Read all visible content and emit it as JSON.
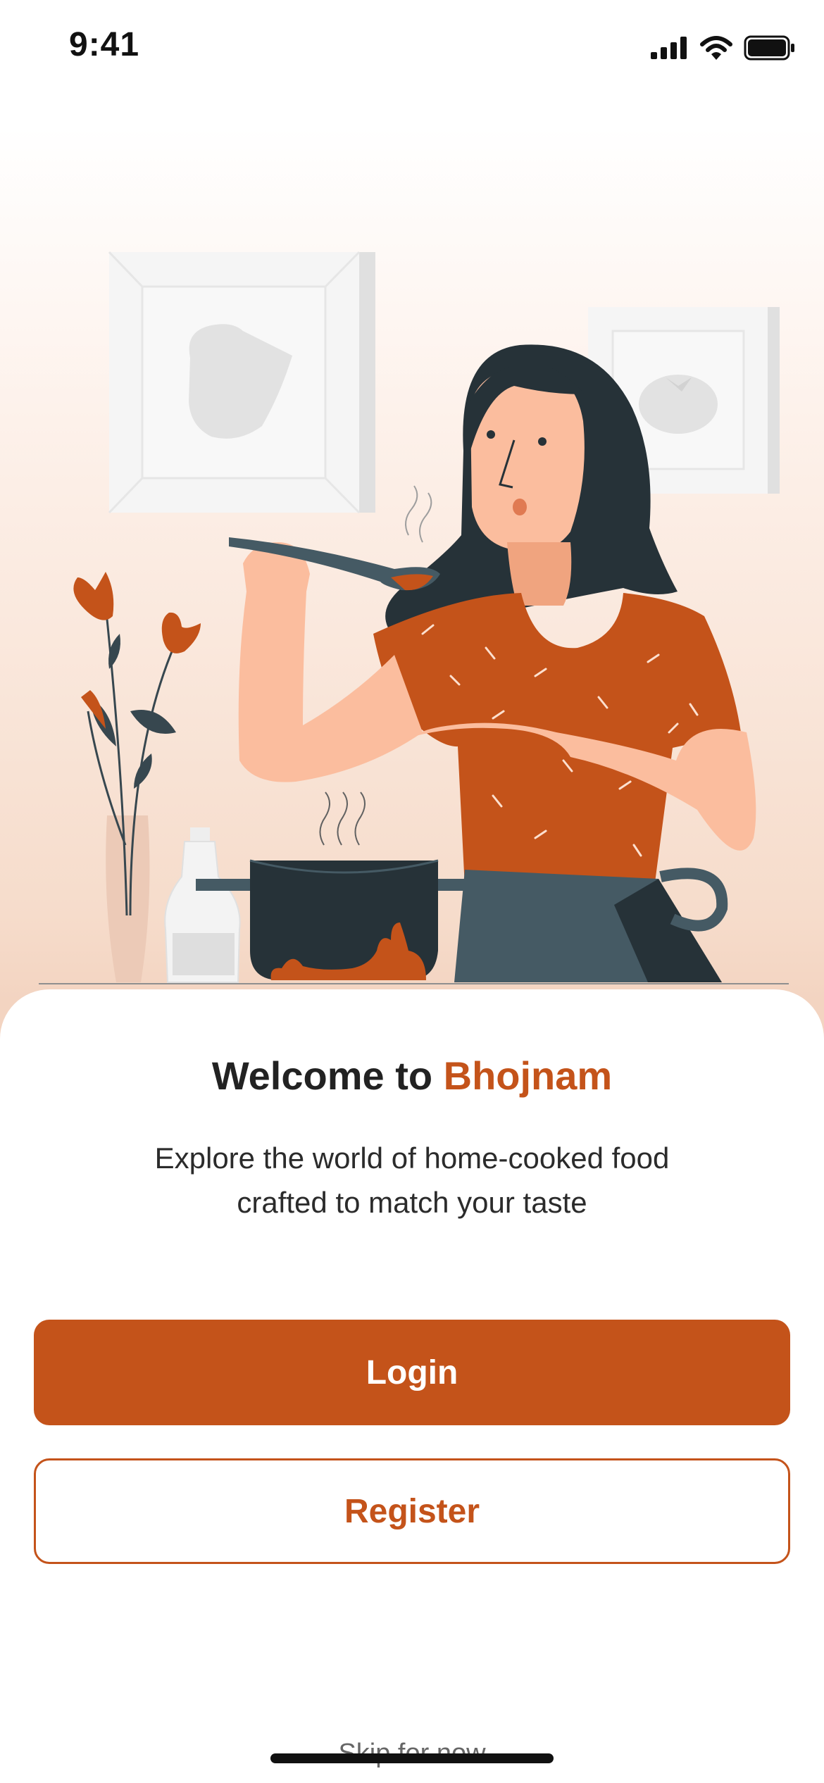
{
  "status_bar": {
    "time": "9:41"
  },
  "welcome": {
    "title_prefix": "Welcome to ",
    "brand_name": "Bhojnam",
    "subtitle_line1": "Explore the world of home-cooked food",
    "subtitle_line2": "crafted to match your taste"
  },
  "actions": {
    "login_label": "Login",
    "register_label": "Register",
    "skip_label": "Skip for now"
  },
  "colors": {
    "accent": "#c4531a",
    "text_dark": "#222222",
    "text_muted": "#666666",
    "illustration_dark": "#263238",
    "skin": "#fbbd9e"
  },
  "illustration": {
    "subject": "woman-tasting-food-illustration"
  }
}
